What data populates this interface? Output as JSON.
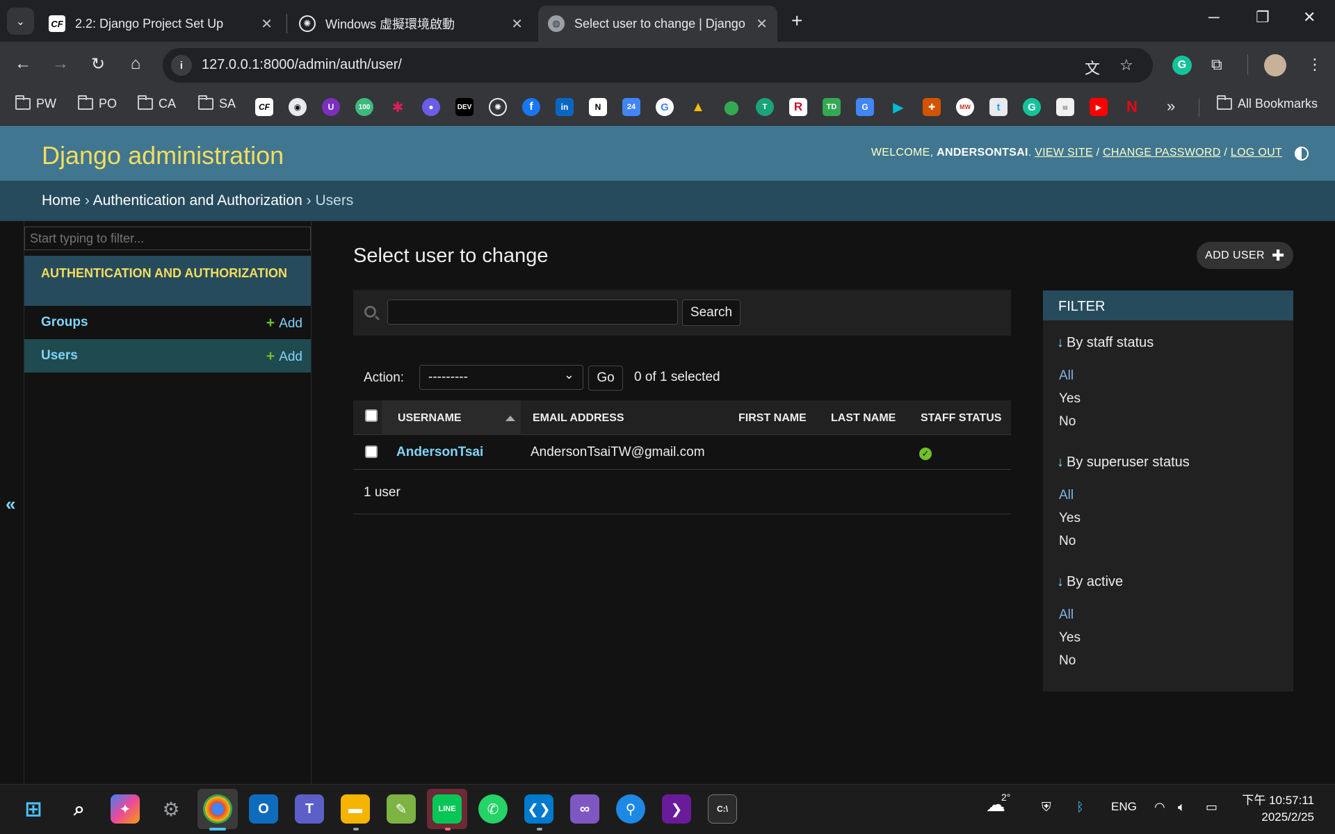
{
  "browser": {
    "tabs": [
      {
        "favicon": "CF",
        "title": "2.2: Django Project Set Up"
      },
      {
        "favicon": "openai-icon",
        "title": "Windows 虛擬環境啟動"
      },
      {
        "favicon": "globe-icon",
        "title": "Select user to change | Django s"
      }
    ],
    "url": "127.0.0.1:8000/admin/auth/user/",
    "bookmark_folders": [
      "PW",
      "PO",
      "CA",
      "SA"
    ],
    "bookmark_icons": [
      "CF",
      "github-icon",
      "U",
      "100",
      "slack-icon",
      "record-icon",
      "DEV",
      "openai-icon",
      "facebook-icon",
      "in",
      "N",
      "24",
      "G",
      "drive-icon",
      "maps-icon",
      "T",
      "R",
      "TD",
      "translate-icon",
      "play-icon",
      "crest-icon",
      "MW",
      "t",
      "G",
      "doc-icon",
      "youtube-icon",
      "N"
    ],
    "all_bookmarks": "All Bookmarks"
  },
  "header": {
    "branding": "Django administration",
    "welcome": "WELCOME,",
    "username": "ANDERSONTSAI",
    "view_site": "VIEW SITE",
    "change_password": "CHANGE PASSWORD",
    "log_out": "LOG OUT",
    "sep": "/"
  },
  "breadcrumbs": {
    "home": "Home",
    "app": "Authentication and Authorization",
    "current": "Users",
    "sep": "›"
  },
  "sidebar": {
    "filter_placeholder": "Start typing to filter...",
    "app_caption": "Authentication and Authorization",
    "models": [
      {
        "name": "Groups",
        "add": "Add"
      },
      {
        "name": "Users",
        "add": "Add"
      }
    ],
    "collapse": "«"
  },
  "content": {
    "title": "Select user to change",
    "add_button": "ADD USER",
    "search_button": "Search",
    "action_label": "Action:",
    "action_selected": "---------",
    "go_button": "Go",
    "selected_count": "0 of 1 selected",
    "columns": [
      "USERNAME",
      "EMAIL ADDRESS",
      "FIRST NAME",
      "LAST NAME",
      "STAFF STATUS"
    ],
    "rows": [
      {
        "username": "AndersonTsai",
        "email": "AndersonTsaiTW@gmail.com",
        "first_name": "",
        "last_name": "",
        "staff_status": "true"
      }
    ],
    "paginator": "1 user"
  },
  "filter": {
    "title": "FILTER",
    "groups": [
      {
        "heading": "By staff status",
        "options": [
          "All",
          "Yes",
          "No"
        ]
      },
      {
        "heading": "By superuser status",
        "options": [
          "All",
          "Yes",
          "No"
        ]
      },
      {
        "heading": "By active",
        "options": [
          "All",
          "Yes",
          "No"
        ]
      }
    ]
  },
  "taskbar": {
    "weather": "2°",
    "lang": "ENG",
    "time": "下午 10:57:11",
    "date": "2025/2/25"
  },
  "colors": {
    "header_bg": "#417690",
    "branding": "#f5dd5d",
    "breadcrumb_bg": "#264b5d",
    "link": "#81d4fa",
    "add_green": "#70bf2b"
  }
}
